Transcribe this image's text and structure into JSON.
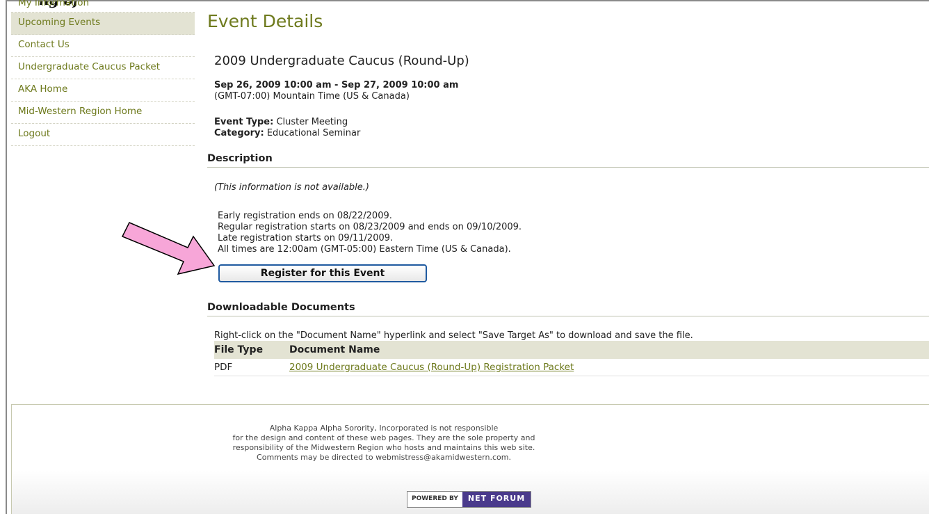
{
  "top_fragment": "ng of",
  "sidebar": {
    "items": [
      {
        "label": "My Information"
      },
      {
        "label": "Upcoming Events"
      },
      {
        "label": "Contact Us"
      },
      {
        "label": "Undergraduate Caucus Packet"
      },
      {
        "label": "AKA Home"
      },
      {
        "label": "Mid-Western Region Home"
      },
      {
        "label": "Logout"
      }
    ]
  },
  "main": {
    "page_title": "Event Details",
    "event_name": "2009 Undergraduate Caucus (Round-Up)",
    "dates": "Sep 26, 2009 10:00 am - Sep 27, 2009 10:00 am",
    "timezone": "(GMT-07:00) Mountain Time (US & Canada)",
    "event_type_label": "Event Type:",
    "event_type_value": "Cluster Meeting",
    "category_label": "Category:",
    "category_value": "Educational Seminar",
    "description_heading": "Description",
    "description_text": "(This information is not available.)",
    "registration_lines": [
      "Early registration ends on 08/22/2009.",
      "Regular registration starts on 08/23/2009 and ends on 09/10/2009.",
      "Late registration starts on 09/11/2009.",
      "All times are 12:00am (GMT-05:00) Eastern Time (US & Canada)."
    ],
    "register_button": "Register for this Event",
    "documents_heading": "Downloadable Documents",
    "documents_hint": "Right-click on the \"Document Name\" hyperlink and select \"Save Target As\" to download and save the file.",
    "documents_columns": [
      "File Type",
      "Document Name"
    ],
    "documents_rows": [
      {
        "type": "PDF",
        "name": "2009 Undergraduate Caucus (Round-Up) Registration Packet"
      }
    ]
  },
  "footer": {
    "lines": [
      "Alpha Kappa Alpha Sorority, Incorporated is not responsible",
      "for the design and content of these web pages. They are the sole property and",
      "responsibility of the Midwestern Region who hosts and maintains this web site.",
      "Comments may be directed to webmistress@akamidwestern.com."
    ],
    "powered_by": "POWERED BY",
    "powered_brand": "NET FORUM"
  },
  "colors": {
    "accent": "#6e7a1d",
    "active_bg": "#e3e3d3",
    "arrow": "#f7a6d8"
  }
}
